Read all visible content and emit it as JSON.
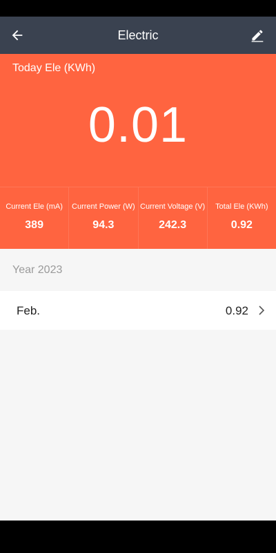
{
  "app_bar": {
    "title": "Electric"
  },
  "icons": {
    "back": "back-arrow-icon",
    "edit": "edit-pencil-icon",
    "chevron": "chevron-right-icon"
  },
  "hero": {
    "label": "Today Ele (KWh)",
    "value": "0.01"
  },
  "stats": [
    {
      "label": "Current Ele (mA)",
      "value": "389"
    },
    {
      "label": "Current Power (W)",
      "value": "94.3"
    },
    {
      "label": "Current Voltage (V)",
      "value": "242.3"
    },
    {
      "label": "Total Ele (KWh)",
      "value": "0.92"
    }
  ],
  "history": {
    "year_label": "Year 2023",
    "months": [
      {
        "label": "Feb.",
        "value": "0.92"
      }
    ]
  },
  "colors": {
    "app_bar": "#3a4250",
    "accent": "#ff6440",
    "background": "#f6f6f6"
  }
}
